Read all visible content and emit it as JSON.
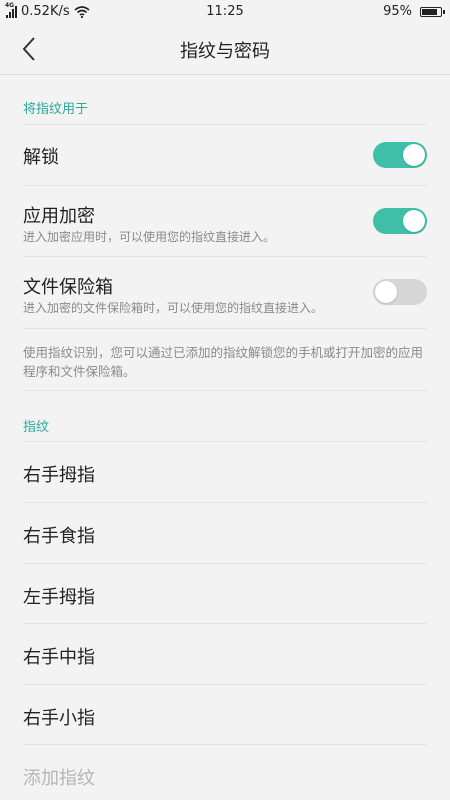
{
  "status_bar": {
    "network": "4G",
    "speed": "0.52K/s",
    "time": "11:25",
    "battery": "95%",
    "battery_level": 0.95,
    "icons": [
      "signal-icon",
      "wifi-icon",
      "battery-icon"
    ]
  },
  "header": {
    "title": "指纹与密码",
    "back_icon": "chevron-left-icon"
  },
  "use_section": {
    "label": "将指纹用于",
    "items": [
      {
        "label": "解锁",
        "sub": "",
        "enabled": true
      },
      {
        "label": "应用加密",
        "sub": "进入加密应用时，可以使用您的指纹直接进入。",
        "enabled": true
      },
      {
        "label": "文件保险箱",
        "sub": "进入加密的文件保险箱时，可以使用您的指纹直接进入。",
        "enabled": false
      }
    ],
    "note": "使用指纹识别，您可以通过已添加的指纹解锁您的手机或打开加密的应用程序和文件保险箱。"
  },
  "fingerprint_section": {
    "label": "指纹",
    "items": [
      "右手拇指",
      "右手食指",
      "左手拇指",
      "右手中指",
      "右手小指"
    ],
    "add_label": "添加指纹"
  },
  "colors": {
    "accent": "#3fbfa7",
    "section_label": "#2aa89a",
    "toggle_off": "#d6d6d6",
    "background": "#f3f3f3"
  }
}
